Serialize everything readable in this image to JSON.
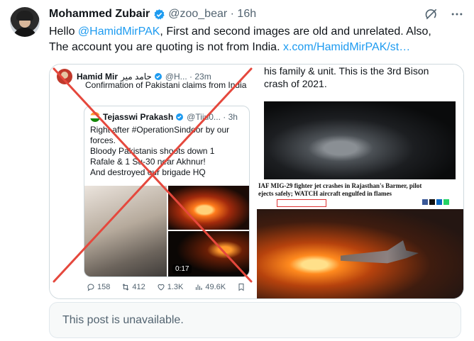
{
  "author": {
    "name": "Mohammed Zubair",
    "handle": "@zoo_bear",
    "time": "16h",
    "verified": true
  },
  "tweet": {
    "line1_prefix": "Hello ",
    "mention": "@HamidMirPAK",
    "line1_suffix": ", First and second images are old and unrelated. Also,",
    "line2_prefix": "The account you are quoting is not from India.  ",
    "link": "x.com/HamidMirPAK/st…"
  },
  "media": {
    "left_panel": {
      "author_name": "Hamid Mir",
      "author_urdu": "حامد میر",
      "author_meta": "@H... · 23m",
      "text": "Confirmation of Pakistani claims from India",
      "quoted": {
        "name": "Tejasswi Prakash",
        "meta": "@Tiju0... · 3h",
        "lines": [
          "Right after #OperationSindoor by our",
          "forces.",
          " Bloody Pakistanis shoots down 1",
          "Rafale & 1 Su-30 near Akhnur!",
          "And destroyed our brigade HQ"
        ],
        "video_time": "0:17"
      },
      "stats": {
        "replies": "158",
        "reposts": "412",
        "likes": "1.3K",
        "views": "49.6K"
      }
    },
    "right_panel": {
      "text_lines": [
        "his family & unit. This is the 3rd Bison",
        "crash of 2021."
      ],
      "headline_lines": [
        "IAF MIG-29 fighter jet crashes in Rajasthan's Barmer, pilot",
        "ejects safely; WATCH aircraft engulfed in flames"
      ]
    }
  },
  "unavailable_text": "This post is unavailable.",
  "colors": {
    "accent": "#1d9bf0",
    "muted": "#536471",
    "cross": "#e5483d"
  }
}
